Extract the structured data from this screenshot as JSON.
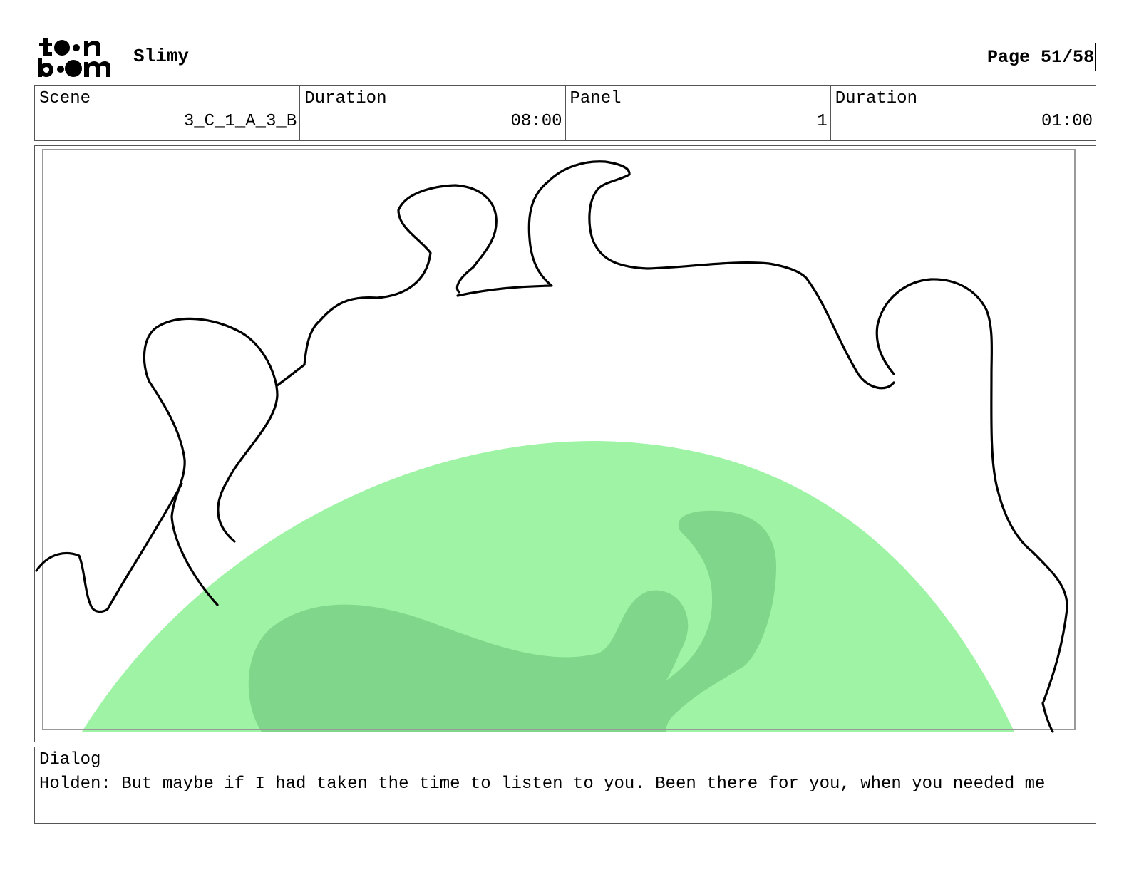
{
  "header": {
    "logo_top": "t••n",
    "logo_bottom": "b••m",
    "project_title": "Slimy",
    "page_label": "Page 51/58"
  },
  "info": [
    {
      "label": "Scene",
      "value": "3_C_1_A_3_B"
    },
    {
      "label": "Duration",
      "value": "08:00"
    },
    {
      "label": "Panel",
      "value": "1"
    },
    {
      "label": "Duration",
      "value": "01:00"
    }
  ],
  "panel": {
    "colors": {
      "slime_light": "#9ef4a4",
      "slime_dark": "#80d68a",
      "ink": "#000000",
      "safe_frame": "#999999"
    }
  },
  "dialog": {
    "label": "Dialog",
    "text": "Holden: But maybe if I had taken the time to listen to you. Been there for you, when you needed me"
  }
}
